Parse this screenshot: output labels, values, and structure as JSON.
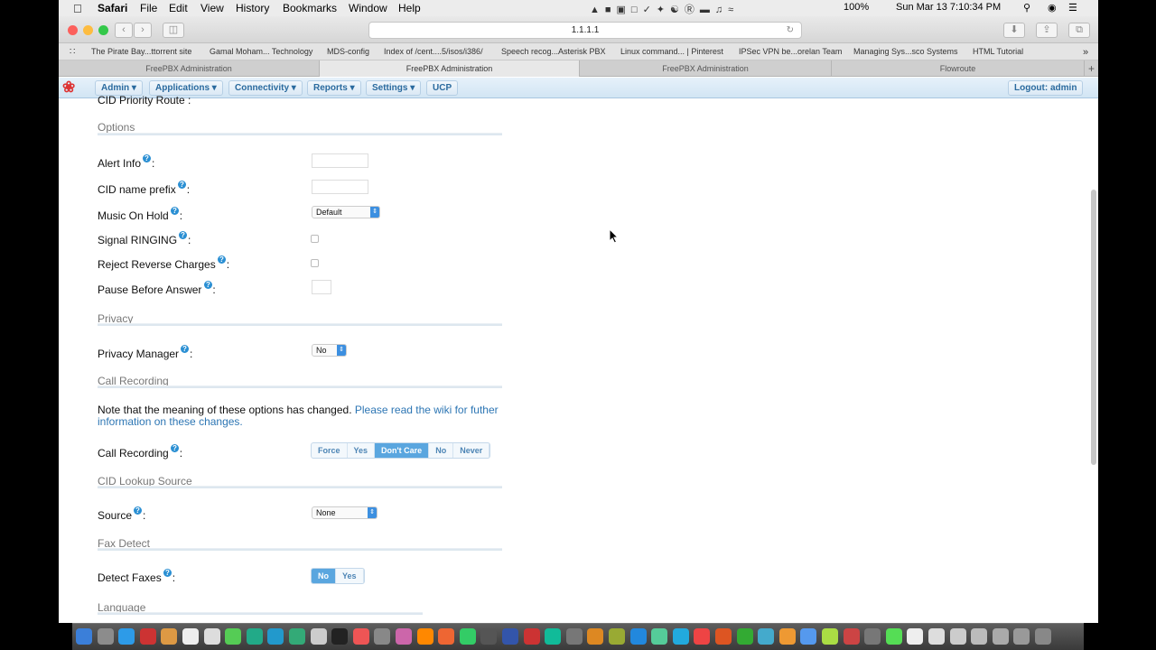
{
  "menubar": {
    "app": "Safari",
    "items": [
      "File",
      "Edit",
      "View",
      "History",
      "Bookmarks",
      "Window",
      "Help"
    ],
    "battery": "100%",
    "clock": "Sun Mar 13  7:10:34 PM"
  },
  "browser": {
    "url": "1.1.1.1"
  },
  "bookmarks": [
    "The Pirate Bay...ttorrent site",
    "Gamal Moham... Technology",
    "MDS-config",
    "Index of /cent....5/isos/i386/",
    "Speech recog...Asterisk PBX",
    "Linux command... | Pinterest",
    "IPSec VPN be...orelan Team",
    "Managing Sys...sco Systems",
    "HTML Tutorial"
  ],
  "tabs": [
    "FreePBX Administration",
    "FreePBX Administration",
    "FreePBX Administration",
    "Flowroute"
  ],
  "fpbx_nav": {
    "items": [
      "Admin",
      "Applications",
      "Connectivity",
      "Reports",
      "Settings",
      "UCP"
    ],
    "logout": "Logout: admin"
  },
  "form": {
    "cut_label": "CID Priority Route",
    "sections": {
      "options": "Options",
      "privacy": "Privacy",
      "call_recording": "Call Recording",
      "cid_lookup": "CID Lookup Source",
      "fax_detect": "Fax Detect",
      "language": "Language"
    },
    "labels": {
      "alert_info": "Alert Info",
      "cid_prefix": "CID name prefix",
      "moh": "Music On Hold",
      "signal_ringing": "Signal RINGING",
      "reject_reverse": "Reject Reverse Charges",
      "pause_before": "Pause Before Answer",
      "privacy_manager": "Privacy Manager",
      "call_recording": "Call Recording",
      "source": "Source",
      "detect_faxes": "Detect Faxes"
    },
    "moh_value": "Default",
    "privacy_value": "No",
    "source_value": "None",
    "note_text": "Note that the meaning of these options has changed.",
    "note_link": "Please read the wiki for futher information on these changes.",
    "recording_options": [
      "Force",
      "Yes",
      "Don't Care",
      "No",
      "Never"
    ],
    "recording_selected": "Don't Care",
    "fax_options": [
      "No",
      "Yes"
    ],
    "fax_selected": "No"
  }
}
